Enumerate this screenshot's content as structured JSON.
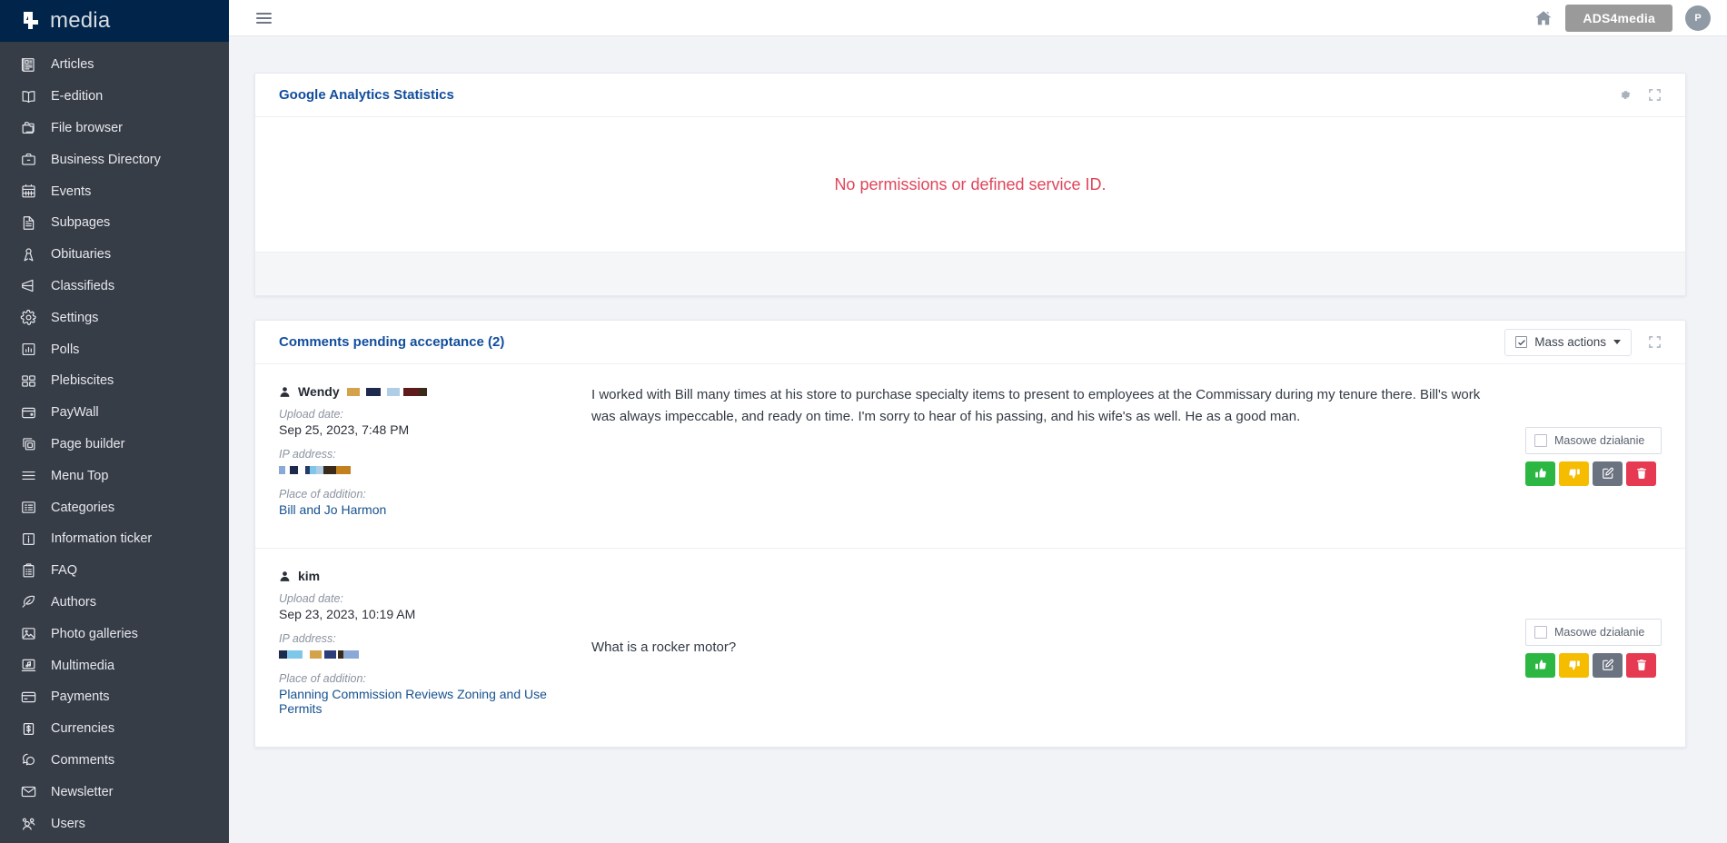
{
  "brand": {
    "name": "media",
    "logo_icon": "ads4media-logo-icon"
  },
  "topbar": {
    "menu_toggle_icon": "hamburger-icon",
    "home_icon": "home-icon",
    "site_name": "ADS4media",
    "avatar_initial": "P"
  },
  "sidebar": {
    "items": [
      {
        "label": "Articles",
        "icon": "newspaper-icon"
      },
      {
        "label": "E-edition",
        "icon": "book-open-icon"
      },
      {
        "label": "File browser",
        "icon": "folders-icon"
      },
      {
        "label": "Business Directory",
        "icon": "briefcase-icon"
      },
      {
        "label": "Events",
        "icon": "calendar-icon"
      },
      {
        "label": "Subpages",
        "icon": "document-icon"
      },
      {
        "label": "Obituaries",
        "icon": "ribbon-icon"
      },
      {
        "label": "Classifieds",
        "icon": "megaphone-icon"
      },
      {
        "label": "Settings",
        "icon": "gear-icon"
      },
      {
        "label": "Polls",
        "icon": "bar-chart-icon"
      },
      {
        "label": "Plebiscites",
        "icon": "layout-blocks-icon"
      },
      {
        "label": "PayWall",
        "icon": "wallet-icon"
      },
      {
        "label": "Page builder",
        "icon": "copy-layers-icon"
      },
      {
        "label": "Menu Top",
        "icon": "menu-lines-icon"
      },
      {
        "label": "Categories",
        "icon": "list-icon"
      },
      {
        "label": "Information ticker",
        "icon": "info-square-icon"
      },
      {
        "label": "FAQ",
        "icon": "clipboard-list-icon"
      },
      {
        "label": "Authors",
        "icon": "feather-pen-icon"
      },
      {
        "label": "Photo galleries",
        "icon": "photo-icon"
      },
      {
        "label": "Multimedia",
        "icon": "media-note-icon"
      },
      {
        "label": "Payments",
        "icon": "credit-card-icon"
      },
      {
        "label": "Currencies",
        "icon": "dollar-square-icon"
      },
      {
        "label": "Comments",
        "icon": "comments-icon"
      },
      {
        "label": "Newsletter",
        "icon": "envelope-icon"
      },
      {
        "label": "Users",
        "icon": "users-icon"
      }
    ]
  },
  "analytics_panel": {
    "title": "Google Analytics Statistics",
    "message": "No permissions or defined service ID.",
    "message_color": "#e0455a",
    "settings_icon": "gear-icon",
    "expand_icon": "expand-icon"
  },
  "comments_panel": {
    "title": "Comments pending acceptance (2)",
    "mass_actions_label": "Mass actions",
    "mass_actions_checkbox_icon": "checkbox-checked-icon",
    "expand_icon": "expand-icon",
    "labels": {
      "upload_date": "Upload date:",
      "ip_address": "IP address:",
      "place_of_addition": "Place of addition:",
      "mass_action": "Masowe działanie"
    },
    "action_buttons": [
      {
        "name": "accept",
        "icon": "thumbs-up-icon",
        "color": "#2cb742"
      },
      {
        "name": "reject",
        "icon": "thumbs-down-icon",
        "color": "#f5bc00"
      },
      {
        "name": "edit",
        "icon": "pencil-square-icon",
        "color": "#6b7280"
      },
      {
        "name": "delete",
        "icon": "trash-icon",
        "color": "#e53a51"
      }
    ],
    "comments": [
      {
        "author": "Wendy",
        "author_redacted": true,
        "upload_date": "Sep 25, 2023, 7:48 PM",
        "ip_redacted": true,
        "place_of_addition": "Bill and Jo Harmon",
        "text": "I worked with Bill many times at his store to purchase specialty items to present to employees at the Commissary during my tenure there. Bill's work was always impeccable, and ready on time. I'm sorry to hear of his passing, and his wife's as well. He as a good man."
      },
      {
        "author": "kim",
        "author_redacted": false,
        "upload_date": "Sep 23, 2023, 10:19 AM",
        "ip_redacted": true,
        "place_of_addition": "Planning Commission Reviews Zoning and Use Permits",
        "text": "What is a rocker motor?"
      }
    ]
  }
}
